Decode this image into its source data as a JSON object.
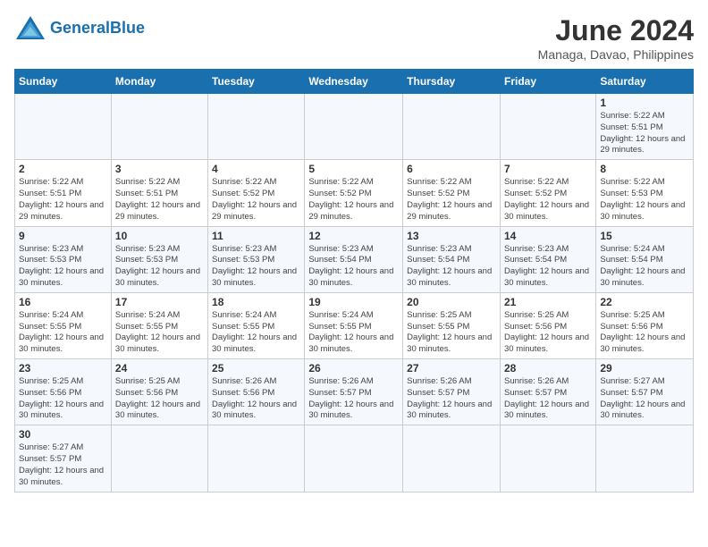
{
  "header": {
    "logo_general": "General",
    "logo_blue": "Blue",
    "month_title": "June 2024",
    "location": "Managa, Davao, Philippines"
  },
  "weekdays": [
    "Sunday",
    "Monday",
    "Tuesday",
    "Wednesday",
    "Thursday",
    "Friday",
    "Saturday"
  ],
  "weeks": [
    [
      {
        "day": "",
        "info": ""
      },
      {
        "day": "",
        "info": ""
      },
      {
        "day": "",
        "info": ""
      },
      {
        "day": "",
        "info": ""
      },
      {
        "day": "",
        "info": ""
      },
      {
        "day": "",
        "info": ""
      },
      {
        "day": "1",
        "info": "Sunrise: 5:22 AM\nSunset: 5:51 PM\nDaylight: 12 hours and 29 minutes."
      }
    ],
    [
      {
        "day": "2",
        "info": "Sunrise: 5:22 AM\nSunset: 5:51 PM\nDaylight: 12 hours and 29 minutes."
      },
      {
        "day": "3",
        "info": "Sunrise: 5:22 AM\nSunset: 5:51 PM\nDaylight: 12 hours and 29 minutes."
      },
      {
        "day": "4",
        "info": "Sunrise: 5:22 AM\nSunset: 5:52 PM\nDaylight: 12 hours and 29 minutes."
      },
      {
        "day": "5",
        "info": "Sunrise: 5:22 AM\nSunset: 5:52 PM\nDaylight: 12 hours and 29 minutes."
      },
      {
        "day": "6",
        "info": "Sunrise: 5:22 AM\nSunset: 5:52 PM\nDaylight: 12 hours and 29 minutes."
      },
      {
        "day": "7",
        "info": "Sunrise: 5:22 AM\nSunset: 5:52 PM\nDaylight: 12 hours and 30 minutes."
      },
      {
        "day": "8",
        "info": "Sunrise: 5:22 AM\nSunset: 5:53 PM\nDaylight: 12 hours and 30 minutes."
      }
    ],
    [
      {
        "day": "9",
        "info": "Sunrise: 5:23 AM\nSunset: 5:53 PM\nDaylight: 12 hours and 30 minutes."
      },
      {
        "day": "10",
        "info": "Sunrise: 5:23 AM\nSunset: 5:53 PM\nDaylight: 12 hours and 30 minutes."
      },
      {
        "day": "11",
        "info": "Sunrise: 5:23 AM\nSunset: 5:53 PM\nDaylight: 12 hours and 30 minutes."
      },
      {
        "day": "12",
        "info": "Sunrise: 5:23 AM\nSunset: 5:54 PM\nDaylight: 12 hours and 30 minutes."
      },
      {
        "day": "13",
        "info": "Sunrise: 5:23 AM\nSunset: 5:54 PM\nDaylight: 12 hours and 30 minutes."
      },
      {
        "day": "14",
        "info": "Sunrise: 5:23 AM\nSunset: 5:54 PM\nDaylight: 12 hours and 30 minutes."
      },
      {
        "day": "15",
        "info": "Sunrise: 5:24 AM\nSunset: 5:54 PM\nDaylight: 12 hours and 30 minutes."
      }
    ],
    [
      {
        "day": "16",
        "info": "Sunrise: 5:24 AM\nSunset: 5:55 PM\nDaylight: 12 hours and 30 minutes."
      },
      {
        "day": "17",
        "info": "Sunrise: 5:24 AM\nSunset: 5:55 PM\nDaylight: 12 hours and 30 minutes."
      },
      {
        "day": "18",
        "info": "Sunrise: 5:24 AM\nSunset: 5:55 PM\nDaylight: 12 hours and 30 minutes."
      },
      {
        "day": "19",
        "info": "Sunrise: 5:24 AM\nSunset: 5:55 PM\nDaylight: 12 hours and 30 minutes."
      },
      {
        "day": "20",
        "info": "Sunrise: 5:25 AM\nSunset: 5:55 PM\nDaylight: 12 hours and 30 minutes."
      },
      {
        "day": "21",
        "info": "Sunrise: 5:25 AM\nSunset: 5:56 PM\nDaylight: 12 hours and 30 minutes."
      },
      {
        "day": "22",
        "info": "Sunrise: 5:25 AM\nSunset: 5:56 PM\nDaylight: 12 hours and 30 minutes."
      }
    ],
    [
      {
        "day": "23",
        "info": "Sunrise: 5:25 AM\nSunset: 5:56 PM\nDaylight: 12 hours and 30 minutes."
      },
      {
        "day": "24",
        "info": "Sunrise: 5:25 AM\nSunset: 5:56 PM\nDaylight: 12 hours and 30 minutes."
      },
      {
        "day": "25",
        "info": "Sunrise: 5:26 AM\nSunset: 5:56 PM\nDaylight: 12 hours and 30 minutes."
      },
      {
        "day": "26",
        "info": "Sunrise: 5:26 AM\nSunset: 5:57 PM\nDaylight: 12 hours and 30 minutes."
      },
      {
        "day": "27",
        "info": "Sunrise: 5:26 AM\nSunset: 5:57 PM\nDaylight: 12 hours and 30 minutes."
      },
      {
        "day": "28",
        "info": "Sunrise: 5:26 AM\nSunset: 5:57 PM\nDaylight: 12 hours and 30 minutes."
      },
      {
        "day": "29",
        "info": "Sunrise: 5:27 AM\nSunset: 5:57 PM\nDaylight: 12 hours and 30 minutes."
      }
    ],
    [
      {
        "day": "30",
        "info": "Sunrise: 5:27 AM\nSunset: 5:57 PM\nDaylight: 12 hours and 30 minutes."
      },
      {
        "day": "",
        "info": ""
      },
      {
        "day": "",
        "info": ""
      },
      {
        "day": "",
        "info": ""
      },
      {
        "day": "",
        "info": ""
      },
      {
        "day": "",
        "info": ""
      },
      {
        "day": "",
        "info": ""
      }
    ]
  ]
}
